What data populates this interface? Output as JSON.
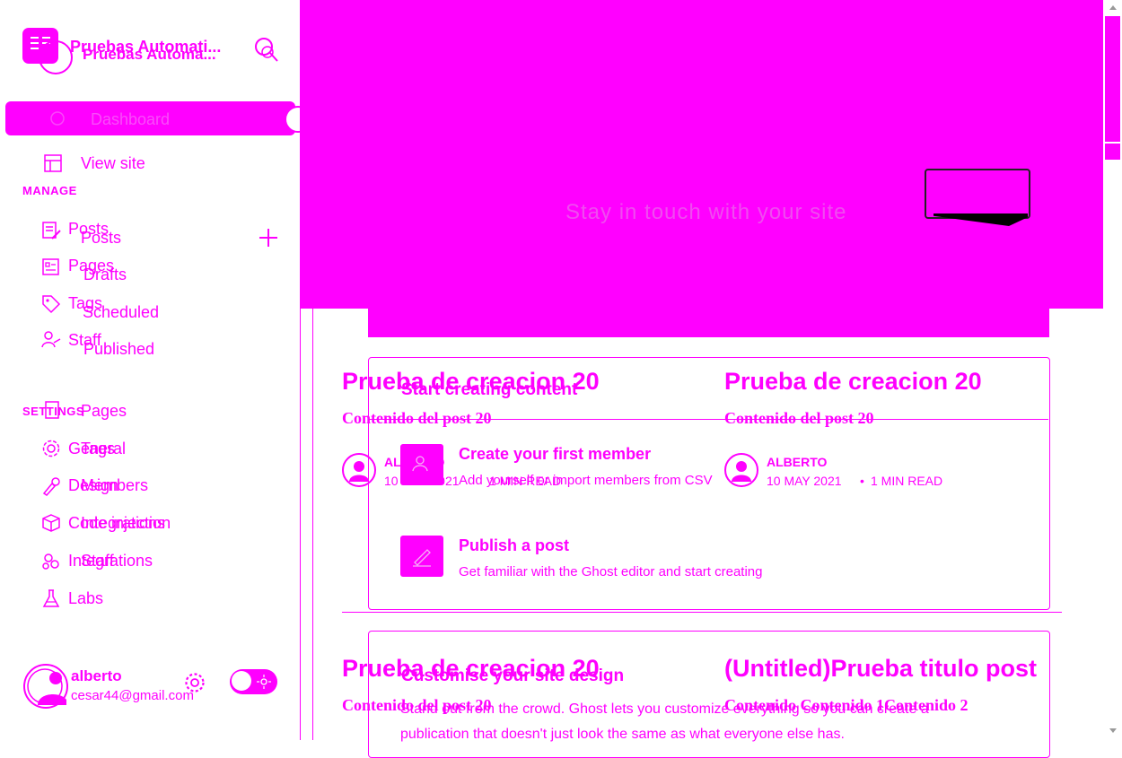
{
  "sidebar": {
    "site_title": "Pruebas Automati...",
    "site_title_echo": "Pruebas Automa...",
    "dashboard_label": "Dashboard",
    "view_site": "View site",
    "manage_heading": "MANAGE",
    "manage_items": [
      "Posts",
      "Pages",
      "Tags",
      "Staff"
    ],
    "posts_submenu": [
      "Posts",
      "Drafts",
      "Scheduled",
      "Published"
    ],
    "settings_heading": "SETTINGS",
    "settings_items": [
      "General",
      "Design",
      "Code injection",
      "Integrations",
      "Labs"
    ],
    "overlay_items": [
      "Pages",
      "Tags",
      "Members",
      "Integrations",
      "Staff"
    ],
    "user": {
      "name": "alberto",
      "email": "cesar44@gmail.com"
    }
  },
  "hero": {
    "text": "Stay in touch with your site"
  },
  "posts": [
    {
      "title": "Prueba de creacion 20",
      "excerpt": "Contenido del post 20",
      "author": "ALBERTO",
      "date": "10 MAY 2021",
      "read": "1 MIN READ"
    },
    {
      "title": "Prueba de creacion 20",
      "excerpt": "Contenido del post 20",
      "author": "ALBERTO",
      "date": "10 MAY 2021",
      "read": "1 MIN READ"
    },
    {
      "title": "Prueba de creacion 20",
      "excerpt": "Contenido del post 20"
    },
    {
      "title": "(Untitled)Prueba titulo post",
      "excerpt": "Contenido Contenido 1Contenido 2"
    }
  ],
  "getting_started": {
    "title": "Start creating content",
    "items": [
      {
        "title": "Create your first member",
        "desc": "Add yourself or import members from CSV"
      },
      {
        "title": "Publish a post",
        "desc": "Get familiar with the Ghost editor and start creating"
      }
    ],
    "customise_title": "Customise your site design",
    "customise_body_1": "Stand out from the crowd. Ghost lets you customize everything so you can create a",
    "customise_body_2": "publication that doesn't just look the same as what everyone else has."
  },
  "colors": {
    "accent": "#ff00ff",
    "background": "#ffffff"
  }
}
